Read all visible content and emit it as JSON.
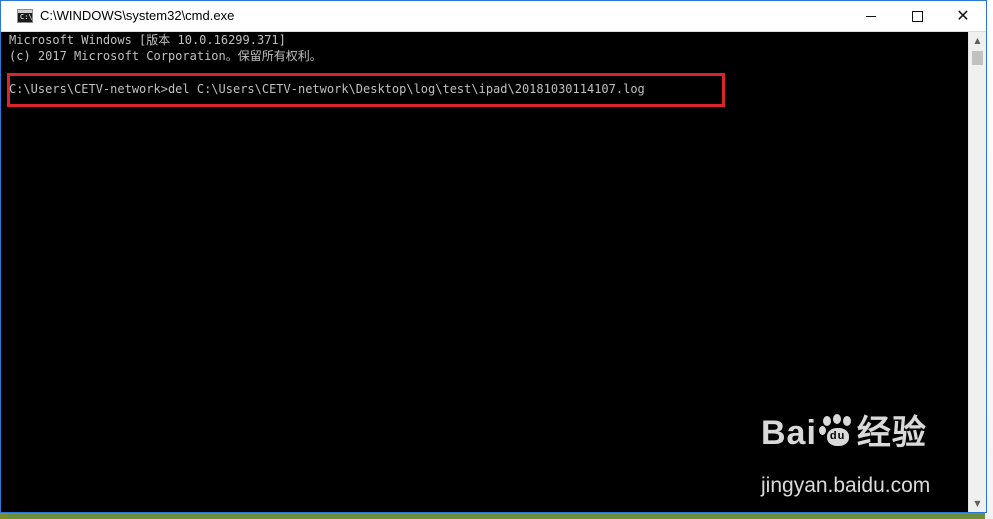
{
  "window": {
    "title": "C:\\WINDOWS\\system32\\cmd.exe",
    "icon": "cmd-icon",
    "icon_glyph": "C:\\",
    "controls": {
      "minimize": "minimize-icon",
      "maximize": "maximize-icon",
      "close": "close-icon",
      "close_glyph": "✕"
    }
  },
  "console": {
    "lines": [
      "Microsoft Windows [版本 10.0.16299.371]",
      "(c) 2017 Microsoft Corporation。保留所有权利。"
    ],
    "command": "C:\\Users\\CETV-network>del C:\\Users\\CETV-network\\Desktop\\log\\test\\ipad\\20181030114107.log",
    "text_color": "#c0c0c0",
    "background": "#000000",
    "highlight_color": "#d8262b"
  },
  "scrollbar": {
    "up_glyph": "▲",
    "down_glyph": "▼"
  },
  "watermark": {
    "brand_left": "Bai",
    "brand_paw_text": "du",
    "brand_right": "经验",
    "url": "jingyan.baidu.com"
  }
}
